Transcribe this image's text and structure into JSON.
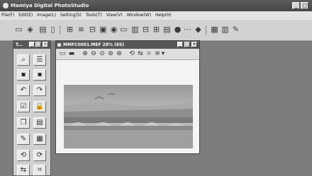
{
  "window": {
    "title": "Mamiya Digital PhotoStudio"
  },
  "menu": [
    "File(F)",
    "Edit(E)",
    "Image(L)",
    "Setting(S)",
    "Tools(T)",
    "View(V)",
    "Window(W)",
    "Help(H)"
  ],
  "toolbar_icons": [
    "open-icon",
    "scan-icon",
    "browse-icon",
    "page-icon",
    "print-icon",
    "film-icon",
    "layer-icon",
    "preview-icon",
    "camera-icon",
    "monitor-icon",
    "grid-icon",
    "adjust-icon",
    "batch-icon",
    "card-icon",
    "disc-icon",
    "transfer-icon",
    "color-icon",
    "export-icon",
    "filter-icon",
    "settings-icon"
  ],
  "palette": {
    "title": "T..."
  },
  "image_window": {
    "title": "MMFC0001.MEF 28% (65)"
  },
  "colors": {
    "accent": "#575757",
    "background": "#7d7d7d"
  }
}
